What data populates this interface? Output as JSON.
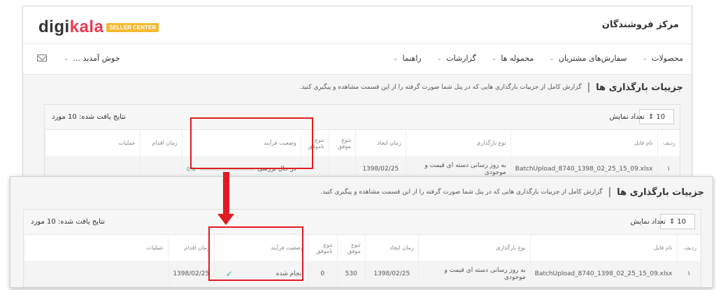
{
  "header": {
    "logo_text_a": "digi",
    "logo_text_b": "kala",
    "logo_badge": "SELLER CENTER",
    "site_title": "مرکز فروشندگان"
  },
  "nav": {
    "items": [
      {
        "label": "محصولات"
      },
      {
        "label": "سفارش‌های مشتریان"
      },
      {
        "label": "محموله ها"
      },
      {
        "label": "گزارشات"
      },
      {
        "label": "راهنما"
      }
    ],
    "welcome": "خوش آمدید ..."
  },
  "page": {
    "title": "جزییات بارگذاری ها",
    "separator": "|",
    "subtitle": "گزارش کامل از جزییات بارگذاری هایی که در پنل شما صورت گرفته را از این قسمت مشاهده و پیگیری کنید."
  },
  "toolbar": {
    "results_label": "نتایج یافت شده: 10 مورد",
    "show_count_label": "تعداد نمایش",
    "page_size": "10"
  },
  "columns": {
    "index": "ردیف",
    "file_name": "نام فایل",
    "upload_type": "نوع بارگذاری",
    "created": "زمان ایجاد",
    "variety_success_a": "تنوع",
    "variety_success_b": "موفق",
    "variety_fail_a": "تنوع",
    "variety_fail_b": "ناموفق",
    "status": "وضعیت فرآیند",
    "action_time": "زمان اقدام",
    "operations": "عملیات"
  },
  "before_row": {
    "index": "۱",
    "file_name": "BatchUpload_8740_1398_02_25_15_09.xlsx",
    "upload_type": "به روز رسانی دسته ای قیمت و موجودی",
    "created": "1398/02/25",
    "status": "در حال بررسی",
    "progress_label": "0%",
    "progress_value": 0
  },
  "after_row": {
    "index": "۱",
    "file_name": "BatchUpload_8740_1398_02_25_15_09.xlsx",
    "upload_type": "به روز رسانی دسته ای قیمت و موجودی",
    "created": "1398/02/25",
    "variety_success": "530",
    "variety_fail": "0",
    "status": "انجام شده",
    "action_time": "1398/02/25"
  },
  "colors": {
    "highlight": "#e11b22",
    "success": "#36b37e",
    "brand": "#ee384e"
  }
}
